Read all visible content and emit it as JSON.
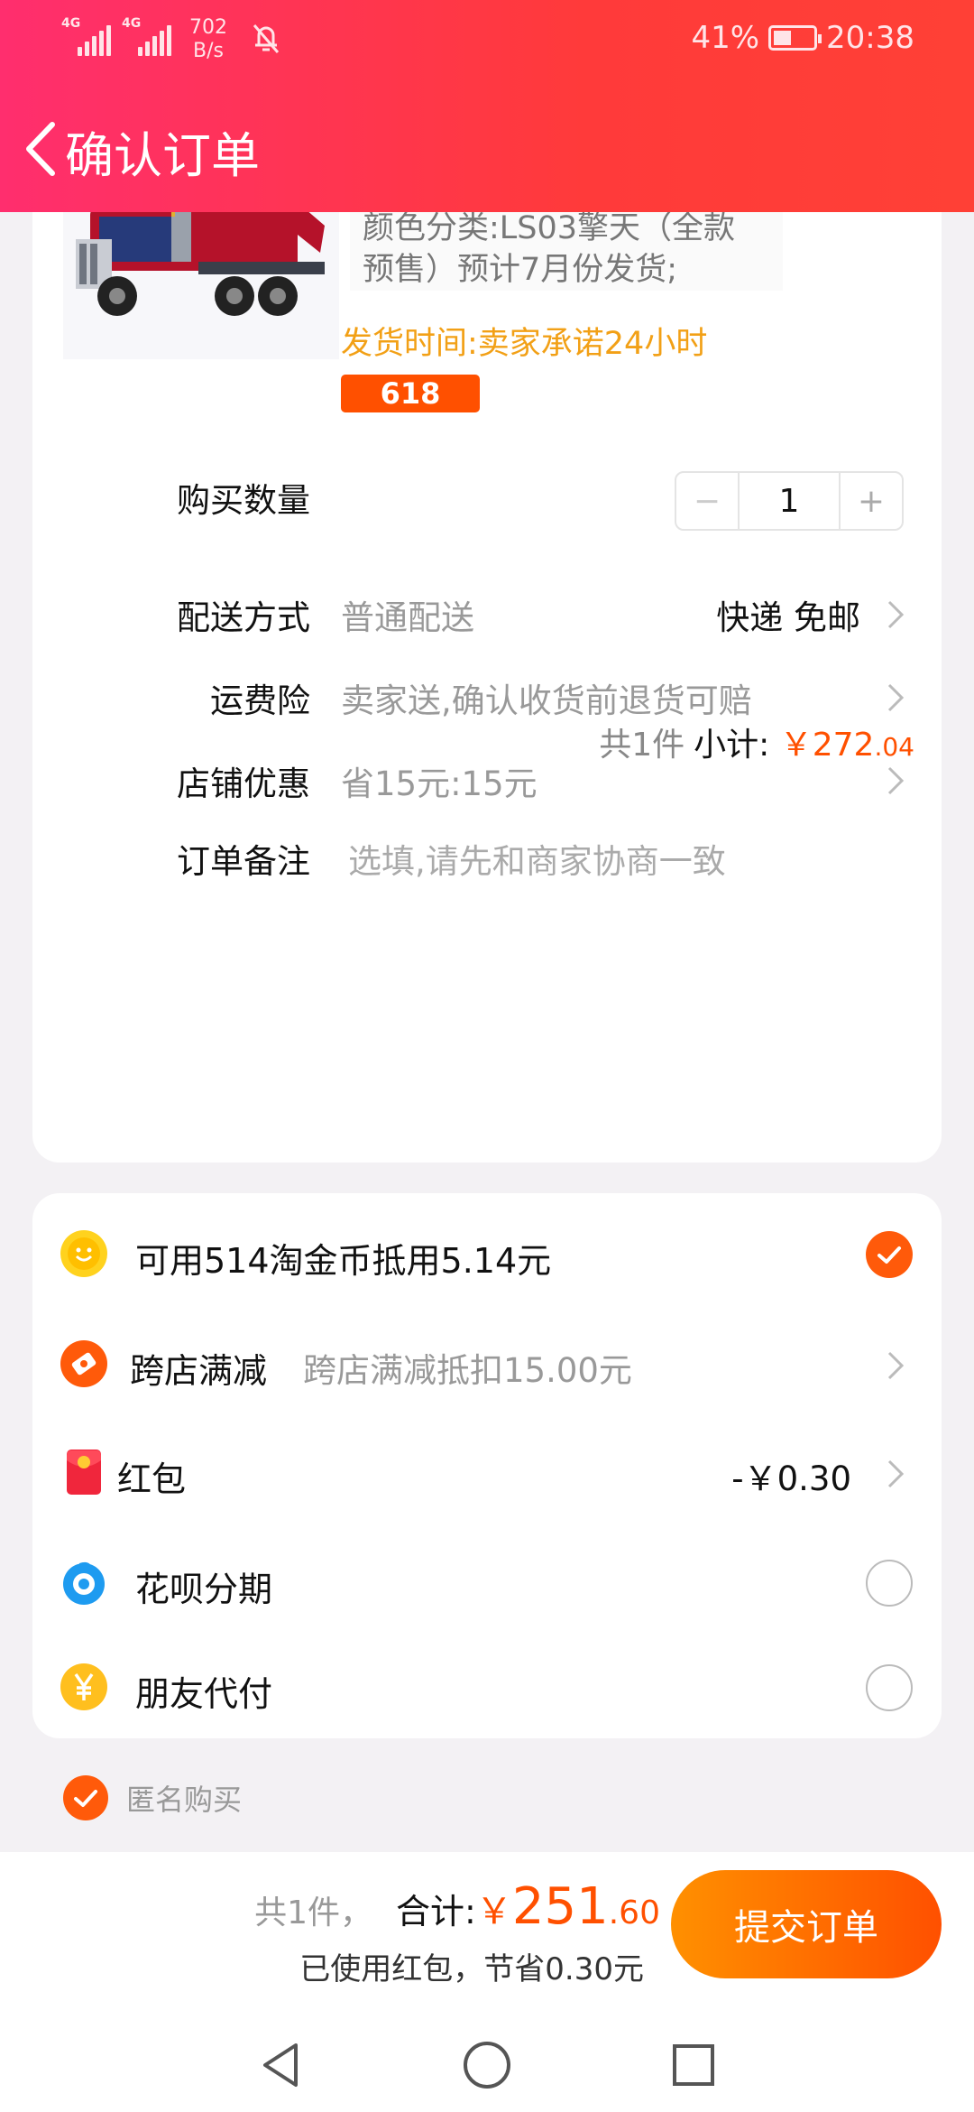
{
  "status_bar": {
    "network_1": "4G",
    "network_2": "4G",
    "speed_value": "702",
    "speed_unit": "B/s",
    "battery": "41%",
    "time": "20:38"
  },
  "header": {
    "title": "确认订单"
  },
  "product": {
    "sku_line1": "颜色分类:LS03擎天（全款",
    "sku_line2": "预售）预计7月份发货;",
    "ship_time": "发货时间:卖家承诺24小时",
    "tag": "618"
  },
  "order_rows": {
    "quantity_label": "购买数量",
    "quantity_value": "1",
    "quantity_minus": "−",
    "quantity_plus": "+",
    "delivery_label": "配送方式",
    "delivery_value": "普通配送",
    "delivery_right": "快递 免邮",
    "insurance_label": "运费险",
    "insurance_value": "卖家送,确认收货前退货可赔",
    "shop_discount_label": "店铺优惠",
    "shop_discount_value": "省15元:15元",
    "note_label": "订单备注",
    "note_placeholder": "选填,请先和商家协商一致"
  },
  "subtotal": {
    "count": "共1件",
    "label": "小计:",
    "currency": "￥",
    "integer": "272",
    "decimal": ".04"
  },
  "benefits": {
    "coins_label": "可用514淘金币抵用5.14元",
    "coins_checked": true,
    "cross_store_label": "跨店满减",
    "cross_store_value": "跨店满减抵扣15.00元",
    "red_packet_label": "红包",
    "red_packet_value": "-￥0.30",
    "huabei_label": "花呗分期",
    "huabei_checked": false,
    "friend_pay_label": "朋友代付",
    "friend_pay_checked": false
  },
  "anonymous": {
    "label": "匿名购买",
    "checked": true
  },
  "bottom": {
    "count": "共1件，",
    "total_label": "合计:",
    "currency": "￥",
    "integer": "251",
    "decimal": ".60",
    "saving_note": "已使用红包，节省0.30元",
    "submit_label": "提交订单"
  },
  "colors": {
    "accent": "#ff5000",
    "header_start": "#ff2e6e",
    "header_end": "#ff4036",
    "ship_time": "#f2a016"
  },
  "icons": {
    "coins": "taojinbi-coin-icon",
    "cross_store": "coupon-ticket-icon",
    "red_packet": "red-packet-icon",
    "huabei": "huabei-icon",
    "friend_pay": "yuan-coin-icon"
  }
}
